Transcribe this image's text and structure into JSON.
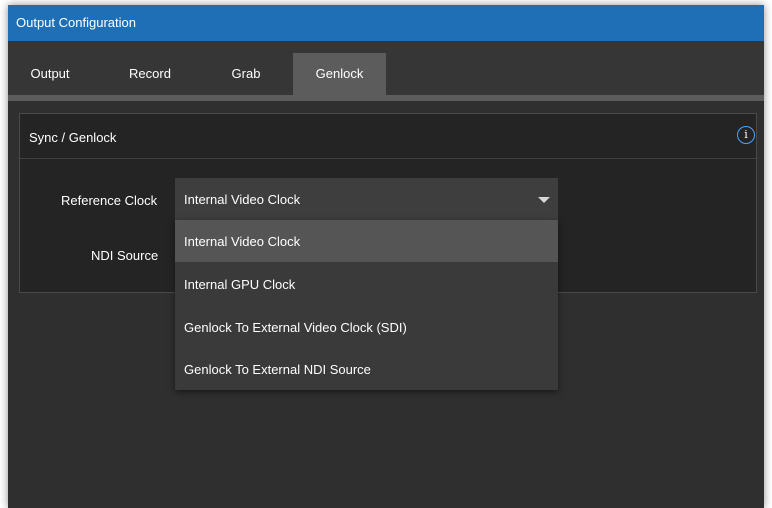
{
  "window": {
    "title": "Output Configuration"
  },
  "tabs": [
    {
      "label": "Output"
    },
    {
      "label": "Record"
    },
    {
      "label": "Grab"
    },
    {
      "label": "Genlock",
      "active": true
    }
  ],
  "panel": {
    "title": "Sync / Genlock",
    "info_icon": "info-icon",
    "reference_clock": {
      "label": "Reference Clock",
      "value": "Internal Video Clock",
      "options": [
        "Internal Video Clock",
        "Internal GPU Clock",
        "Genlock To External Video Clock (SDI)",
        "Genlock To External NDI Source"
      ],
      "highlighted_index": 0
    },
    "ndi_source": {
      "label": "NDI Source"
    }
  },
  "colors": {
    "title_bar": "#1f6fb7",
    "background": "#2f2f2f",
    "active_tab": "#5c5c5c",
    "accent": "#4aa3ff"
  }
}
